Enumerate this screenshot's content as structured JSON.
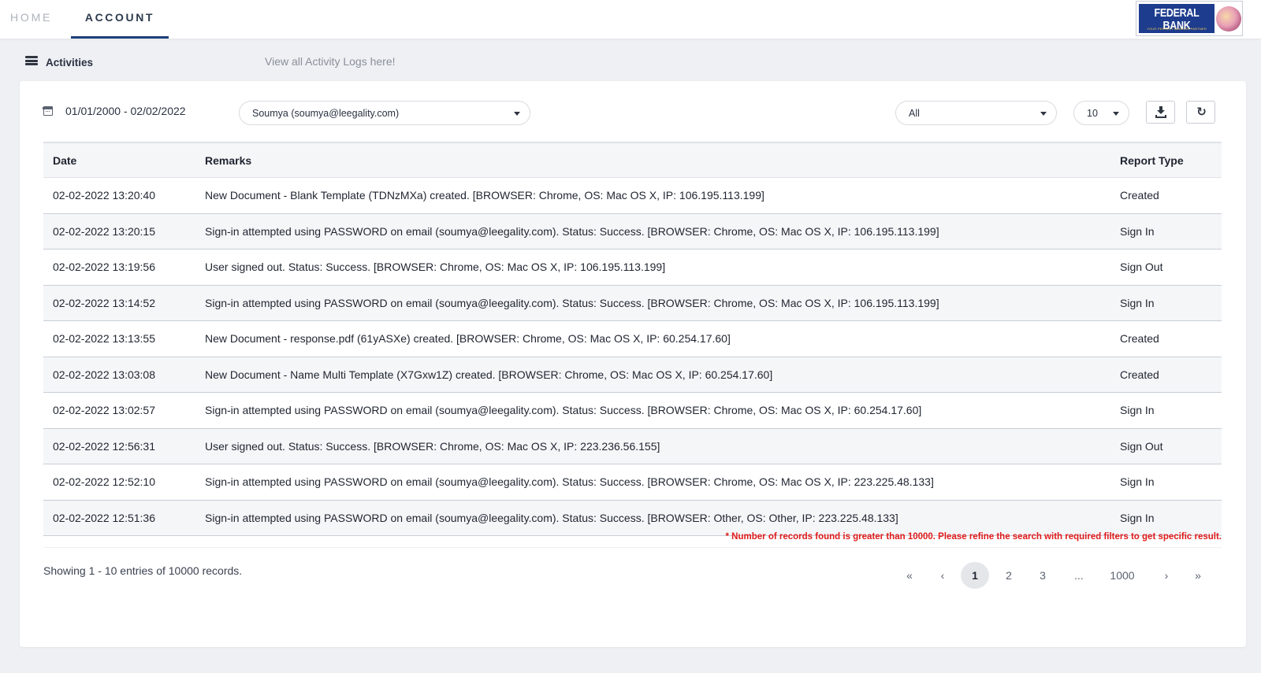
{
  "nav": {
    "home": "HOME",
    "account": "ACCOUNT"
  },
  "logo": {
    "name": "FEDERAL BANK",
    "tagline": "YOUR PERFECT BANKING PARTNER"
  },
  "subheader": {
    "title": "Activities",
    "link": "View all Activity Logs here!"
  },
  "filters": {
    "date_range": "01/01/2000 - 02/02/2022",
    "user": "Soumya (soumya@leegality.com)",
    "report_type": "All",
    "page_size": "10"
  },
  "icons": {
    "menu": "list-icon",
    "calendar": "calendar-icon",
    "download": "download-icon",
    "refresh": "refresh-icon",
    "refresh_glyph": "↻"
  },
  "table": {
    "headers": {
      "date": "Date",
      "remarks": "Remarks",
      "type": "Report Type"
    },
    "rows": [
      {
        "date": "02-02-2022 13:20:40",
        "remarks": "New Document - Blank Template (TDNzMXa) created. [BROWSER: Chrome, OS: Mac OS X, IP: 106.195.113.199]",
        "type": "Created"
      },
      {
        "date": "02-02-2022 13:20:15",
        "remarks": "Sign-in attempted using PASSWORD on email (soumya@leegality.com). Status: Success. [BROWSER: Chrome, OS: Mac OS X, IP: 106.195.113.199]",
        "type": "Sign In"
      },
      {
        "date": "02-02-2022 13:19:56",
        "remarks": "User signed out. Status: Success. [BROWSER: Chrome, OS: Mac OS X, IP: 106.195.113.199]",
        "type": "Sign Out"
      },
      {
        "date": "02-02-2022 13:14:52",
        "remarks": "Sign-in attempted using PASSWORD on email (soumya@leegality.com). Status: Success. [BROWSER: Chrome, OS: Mac OS X, IP: 106.195.113.199]",
        "type": "Sign In"
      },
      {
        "date": "02-02-2022 13:13:55",
        "remarks": "New Document - response.pdf (61yASXe) created. [BROWSER: Chrome, OS: Mac OS X, IP: 60.254.17.60]",
        "type": "Created"
      },
      {
        "date": "02-02-2022 13:03:08",
        "remarks": "New Document - Name Multi Template (X7Gxw1Z) created. [BROWSER: Chrome, OS: Mac OS X, IP: 60.254.17.60]",
        "type": "Created"
      },
      {
        "date": "02-02-2022 13:02:57",
        "remarks": "Sign-in attempted using PASSWORD on email (soumya@leegality.com). Status: Success. [BROWSER: Chrome, OS: Mac OS X, IP: 60.254.17.60]",
        "type": "Sign In"
      },
      {
        "date": "02-02-2022 12:56:31",
        "remarks": "User signed out. Status: Success. [BROWSER: Chrome, OS: Mac OS X, IP: 223.236.56.155]",
        "type": "Sign Out"
      },
      {
        "date": "02-02-2022 12:52:10",
        "remarks": "Sign-in attempted using PASSWORD on email (soumya@leegality.com). Status: Success. [BROWSER: Chrome, OS: Mac OS X, IP: 223.225.48.133]",
        "type": "Sign In"
      },
      {
        "date": "02-02-2022 12:51:36",
        "remarks": "Sign-in attempted using PASSWORD on email (soumya@leegality.com). Status: Success. [BROWSER: Other, OS: Other, IP: 223.225.48.133]",
        "type": "Sign In"
      }
    ]
  },
  "warning": "* Number of records found is greater than 10000. Please refine the search with required filters to get specific result.",
  "footer": {
    "showing": "Showing 1 - 10 entries of 10000 records."
  },
  "pagination": {
    "first": "«",
    "prev": "‹",
    "pages": [
      "1",
      "2",
      "3",
      "...",
      "1000"
    ],
    "current": "1",
    "next": "›",
    "last": "»"
  },
  "colors": {
    "accent": "#1c3f7a",
    "warning": "#e01b1b",
    "logo_bg": "#1d3c8e"
  }
}
